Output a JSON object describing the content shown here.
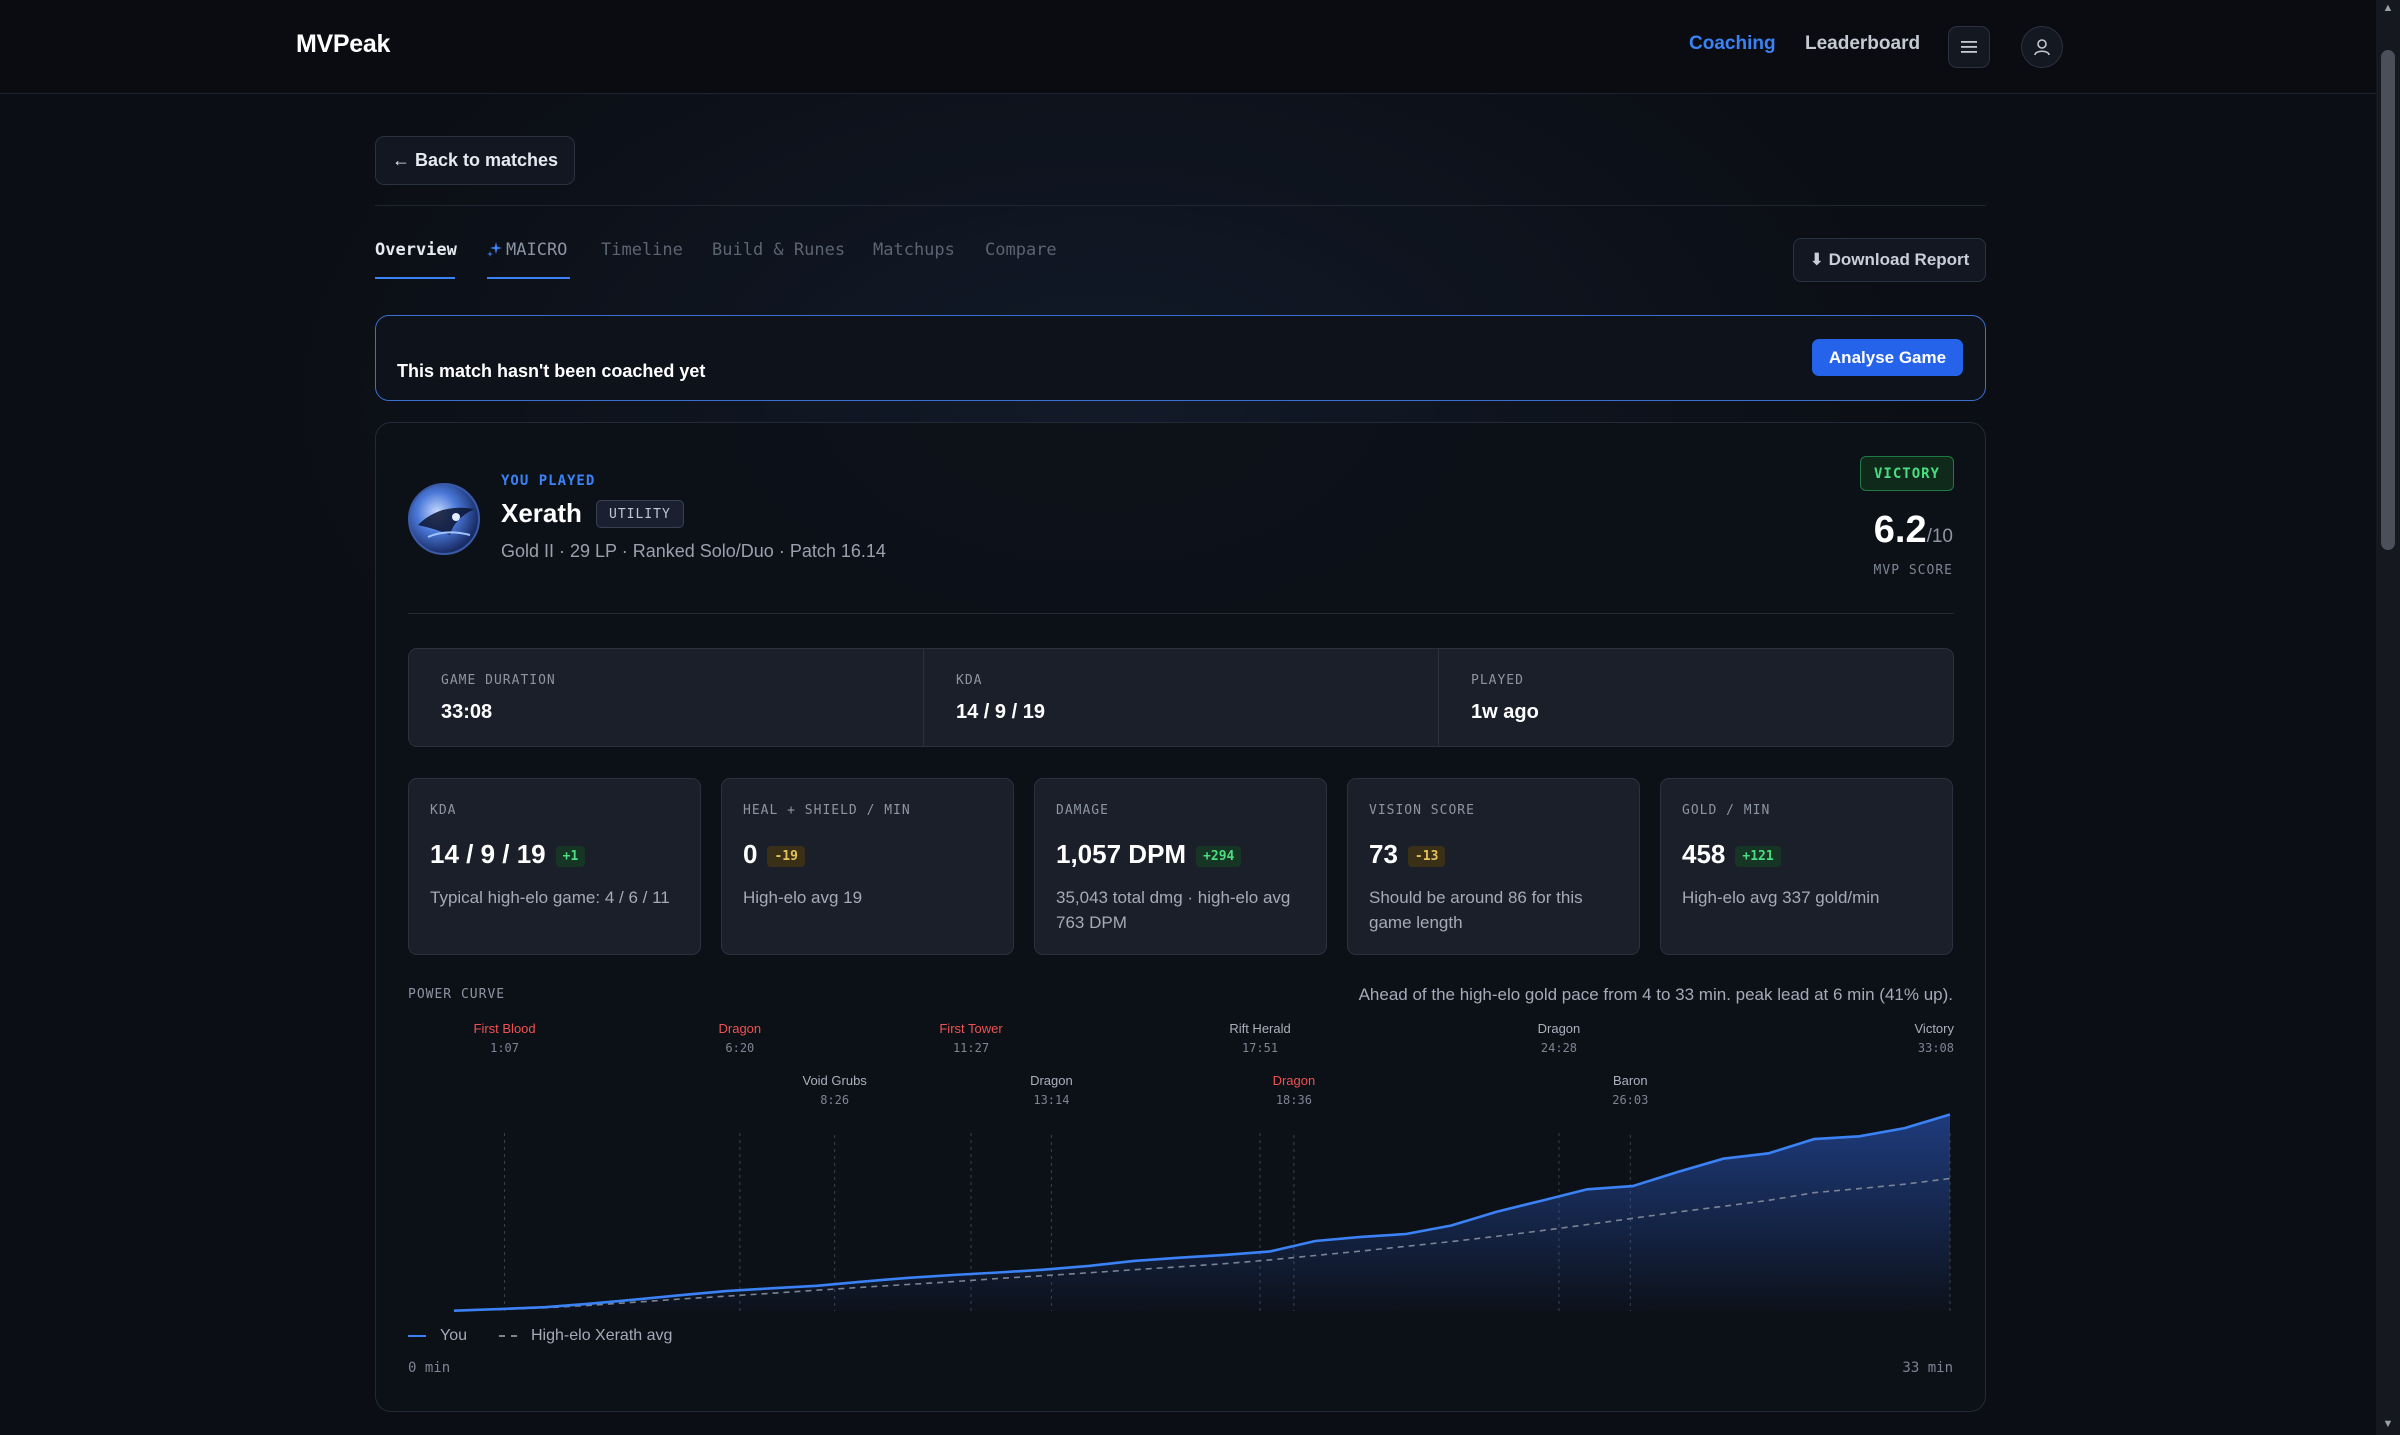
{
  "app": {
    "brand": "MVPeak"
  },
  "nav": {
    "coaching": "Coaching",
    "leaderboard": "Leaderboard"
  },
  "back_button": "← Back to matches",
  "tabs": [
    {
      "label": "Overview",
      "active": true
    },
    {
      "label": "MAICRO",
      "ai": true
    },
    {
      "label": "Timeline"
    },
    {
      "label": "Build & Runes"
    },
    {
      "label": "Matchups"
    },
    {
      "label": "Compare"
    }
  ],
  "download_button": "⬇ Download Report",
  "banner": {
    "text": "This match hasn't been coached yet",
    "button": "Analyse Game"
  },
  "match": {
    "you_played": "YOU PLAYED",
    "champion": "Xerath",
    "role": "UTILITY",
    "subline": "Gold II · 29 LP · Ranked Solo/Duo · Patch 16.14",
    "result": "VICTORY",
    "mvp_value": "6.2",
    "mvp_den": "/10",
    "mvp_label": "MVP SCORE"
  },
  "summary": [
    {
      "label": "GAME DURATION",
      "value": "33:08"
    },
    {
      "label": "KDA",
      "value": "14 / 9 / 19"
    },
    {
      "label": "PLAYED",
      "value": "1w ago"
    }
  ],
  "stats": [
    {
      "label": "KDA",
      "value": "14 / 9 / 19",
      "delta": "+1",
      "delta_type": "pos",
      "desc": "Typical high-elo game: 4 / 6 / 11"
    },
    {
      "label": "HEAL + SHIELD / MIN",
      "value": "0",
      "delta": "-19",
      "delta_type": "neg",
      "desc": "High-elo avg 19"
    },
    {
      "label": "DAMAGE",
      "value": "1,057 DPM",
      "delta": "+294",
      "delta_type": "pos",
      "desc": "35,043 total dmg · high-elo avg 763 DPM"
    },
    {
      "label": "VISION SCORE",
      "value": "73",
      "delta": "-13",
      "delta_type": "neg",
      "desc": "Should be around 86 for this game length"
    },
    {
      "label": "GOLD / MIN",
      "value": "458",
      "delta": "+121",
      "delta_type": "pos",
      "desc": "High-elo avg 337 gold/min"
    }
  ],
  "power_curve": {
    "label": "POWER CURVE",
    "summary": "Ahead of the high-elo gold pace from 4 to 33 min. peak lead at 6 min (41% up).",
    "legend_you": "You",
    "legend_avg": "High-elo Xerath avg",
    "axis_start": "0 min",
    "axis_end": "33 min"
  },
  "chart_data": {
    "type": "area",
    "x_range": [
      0,
      33.13
    ],
    "events": [
      {
        "name": "First Blood",
        "time": "1:07",
        "minute": 1.12,
        "row": 0,
        "highlight": true
      },
      {
        "name": "Dragon",
        "time": "6:20",
        "minute": 6.33,
        "row": 0,
        "highlight": true
      },
      {
        "name": "Void Grubs",
        "time": "8:26",
        "minute": 8.43,
        "row": 1,
        "highlight": false
      },
      {
        "name": "First Tower",
        "time": "11:27",
        "minute": 11.45,
        "row": 0,
        "highlight": true
      },
      {
        "name": "Dragon",
        "time": "13:14",
        "minute": 13.23,
        "row": 1,
        "highlight": false
      },
      {
        "name": "Rift Herald",
        "time": "17:51",
        "minute": 17.85,
        "row": 0,
        "highlight": false
      },
      {
        "name": "Dragon",
        "time": "18:36",
        "minute": 18.6,
        "row": 1,
        "highlight": true
      },
      {
        "name": "Dragon",
        "time": "24:28",
        "minute": 24.47,
        "row": 0,
        "highlight": false
      },
      {
        "name": "Baron",
        "time": "26:03",
        "minute": 26.05,
        "row": 1,
        "highlight": false
      },
      {
        "name": "Victory",
        "time": "33:08",
        "minute": 33.13,
        "row": 0,
        "highlight": false
      }
    ],
    "series": [
      {
        "name": "You",
        "values": [
          0.1,
          0.6,
          1.2,
          2.3,
          3.6,
          5.0,
          6.3,
          7.2,
          8.0,
          9.3,
          10.5,
          11.4,
          12.2,
          13.1,
          14.3,
          15.9,
          16.9,
          17.8,
          18.9,
          22.2,
          23.5,
          24.4,
          27.1,
          31.5,
          35.0,
          38.6,
          39.6,
          44.1,
          48.3,
          50.0,
          54.5,
          55.4,
          58.0,
          62.3
        ]
      },
      {
        "name": "High-elo Xerath avg",
        "values": [
          0.1,
          0.5,
          1.0,
          1.8,
          2.8,
          3.8,
          4.7,
          5.6,
          6.6,
          7.5,
          8.4,
          9.3,
          10.3,
          11.2,
          12.1,
          13.1,
          14.0,
          15.0,
          16.2,
          17.6,
          19.0,
          20.5,
          22.0,
          23.7,
          25.5,
          27.4,
          29.4,
          31.4,
          33.2,
          35.1,
          37.5,
          38.8,
          40.2,
          42.0
        ]
      }
    ],
    "y_range": [
      0,
      65
    ]
  }
}
